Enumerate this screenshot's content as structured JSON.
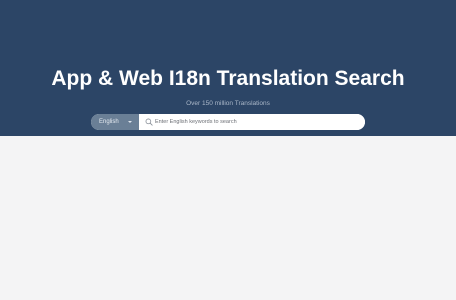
{
  "header": {
    "title": "App & Web I18n Translation Search",
    "subtitle": "Over 150 million Translations"
  },
  "search": {
    "language": "English",
    "placeholder": "Enter English keywords to search",
    "value": ""
  },
  "colors": {
    "hero_bg": "#2c4566",
    "select_bg": "#6a7f96",
    "page_bg": "#f4f4f5"
  },
  "icons": {
    "search": "search-icon",
    "dropdown": "chevron-down-icon"
  }
}
